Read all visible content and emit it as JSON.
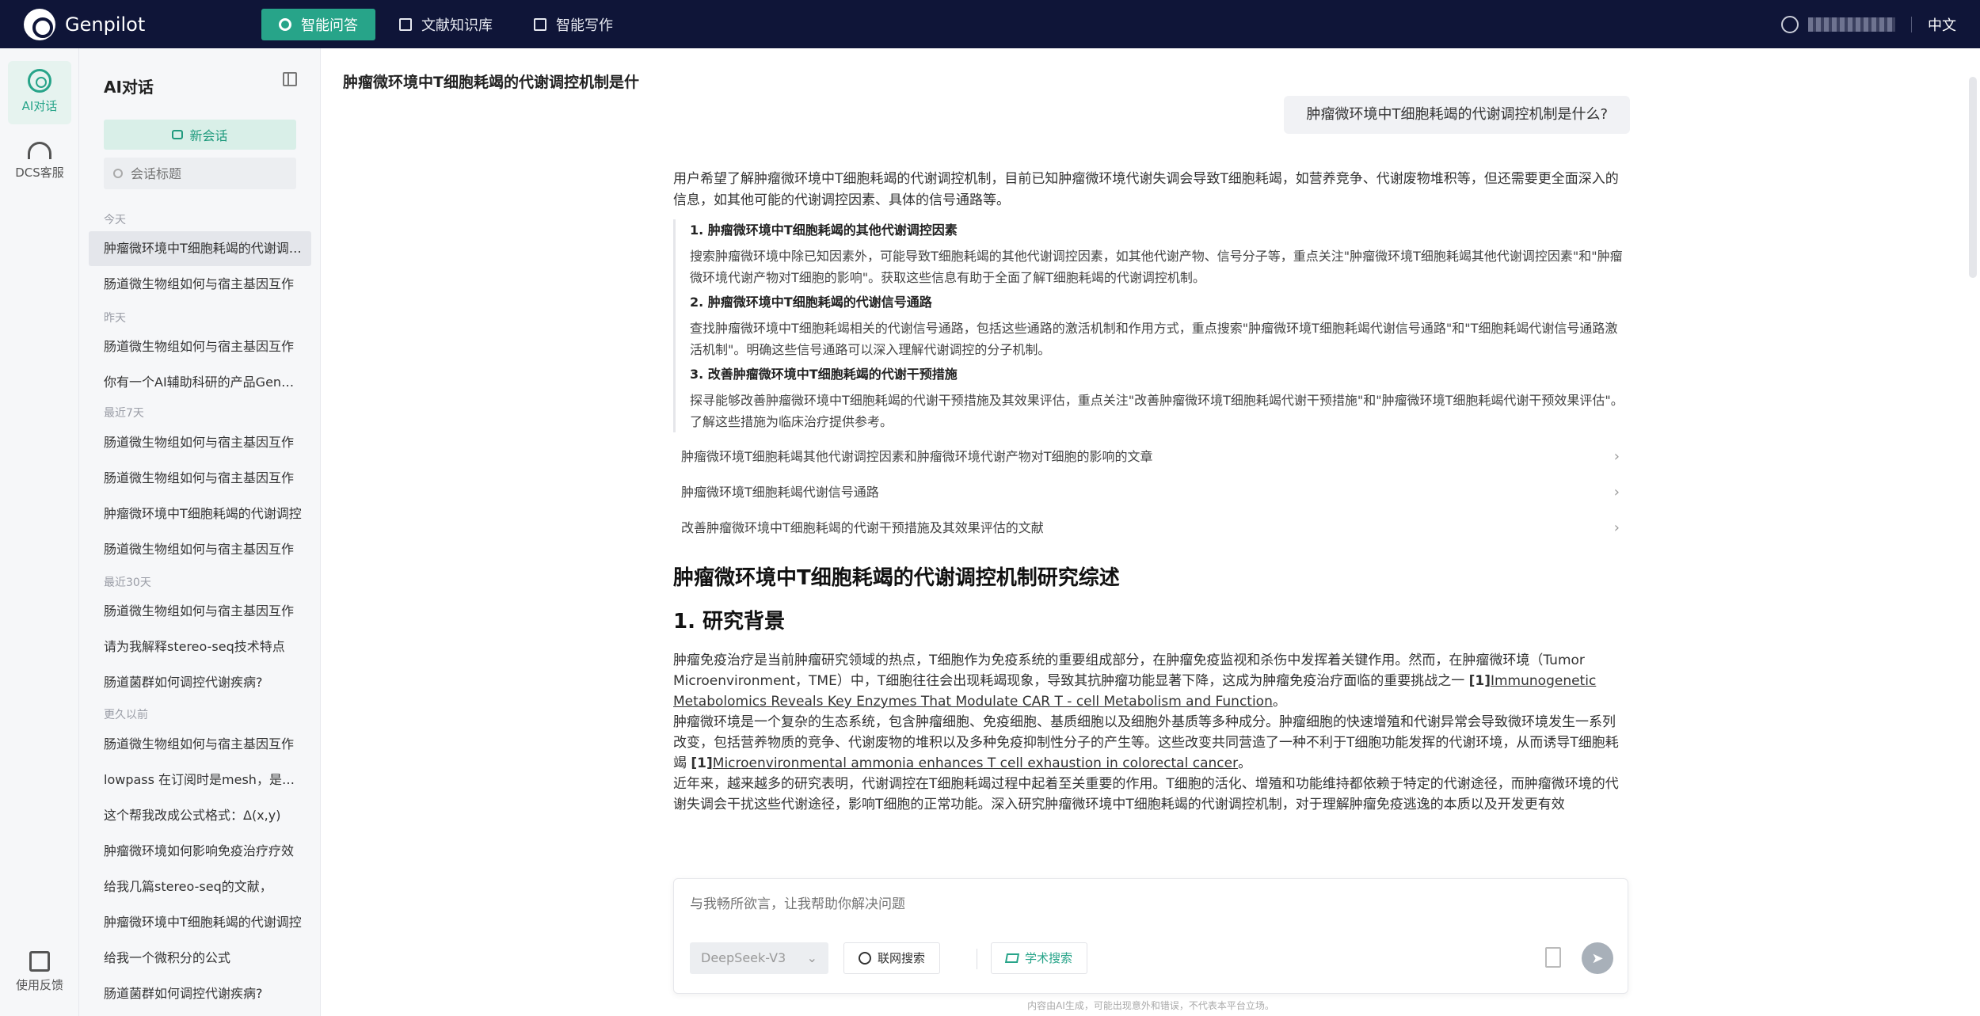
{
  "brand": {
    "name": "Genpilot"
  },
  "nav": [
    {
      "label": "智能问答",
      "icon": "gear-icon",
      "active": true
    },
    {
      "label": "文献知识库",
      "icon": "book-icon",
      "active": false
    },
    {
      "label": "智能写作",
      "icon": "pen-icon",
      "active": false
    }
  ],
  "topbar": {
    "language": "中文"
  },
  "rail": {
    "ai_chat": "AI对话",
    "dcs": "DCS客服",
    "feedback": "使用反馈"
  },
  "sidebar": {
    "title": "AI对话",
    "new_chat": "新会话",
    "search_placeholder": "会话标题",
    "groups": {
      "today": "今天",
      "yesterday": "昨天",
      "last7": "最近7天",
      "last30": "最近30天",
      "older": "更久以前"
    },
    "items": [
      "肿瘤微环境中T细胞耗竭的代谢调控机制是什么？",
      "肠道微生物组如何与宿主基因互作",
      "肠道微生物组如何与宿主基因互作",
      "你有一个AI辅助科研的产品Genpilot",
      "肠道微生物组如何与宿主基因互作",
      "肠道微生物组如何与宿主基因互作",
      "肿瘤微环境中T细胞耗竭的代谢调控",
      "肠道微生物组如何与宿主基因互作",
      "肠道微生物组如何与宿主基因互作",
      "请为我解释stereo-seq技术特点",
      "肠道菌群如何调控代谢疾病?",
      "肠道微生物组如何与宿主基因互作",
      "lowpass 在订阅时是mesh，是什么",
      "这个帮我改成公式格式：Δ(x,y)",
      "肿瘤微环境如何影响免疫治疗疗效",
      "给我几篇stereo-seq的文献，",
      "肿瘤微环境中T细胞耗竭的代谢调控",
      "给我一个微积分的公式",
      "肠道菌群如何调控代谢疾病?"
    ]
  },
  "main": {
    "conversation_title": "肿瘤微环境中T细胞耗竭的代谢调控机制是什",
    "user_question": "肿瘤微环境中T细胞耗竭的代谢调控机制是什么?",
    "intro": "用户希望了解肿瘤微环境中T细胞耗竭的代谢调控机制，目前已知肿瘤微环境代谢失调会导致T细胞耗竭，如营养竞争、代谢废物堆积等，但还需要更全面深入的信息，如其他可能的代谢调控因素、具体的信号通路等。",
    "plan": [
      {
        "heading": "1. 肿瘤微环境中T细胞耗竭的其他代谢调控因素",
        "text": "搜索肿瘤微环境中除已知因素外，可能导致T细胞耗竭的其他代谢调控因素，如其他代谢产物、信号分子等，重点关注\"肿瘤微环境T细胞耗竭其他代谢调控因素\"和\"肿瘤微环境代谢产物对T细胞的影响\"。获取这些信息有助于全面了解T细胞耗竭的代谢调控机制。"
      },
      {
        "heading": "2. 肿瘤微环境中T细胞耗竭的代谢信号通路",
        "text": "查找肿瘤微环境中T细胞耗竭相关的代谢信号通路，包括这些通路的激活机制和作用方式，重点搜索\"肿瘤微环境T细胞耗竭代谢信号通路\"和\"T细胞耗竭代谢信号通路激活机制\"。明确这些信号通路可以深入理解代谢调控的分子机制。"
      },
      {
        "heading": "3. 改善肿瘤微环境中T细胞耗竭的代谢干预措施",
        "text": "探寻能够改善肿瘤微环境中T细胞耗竭的代谢干预措施及其效果评估，重点关注\"改善肿瘤微环境T细胞耗竭代谢干预措施\"和\"肿瘤微环境T细胞耗竭代谢干预效果评估\"。了解这些措施为临床治疗提供参考。"
      }
    ],
    "references": [
      "肿瘤微环境T细胞耗竭其他代谢调控因素和肿瘤微环境代谢产物对T细胞的影响的文章",
      "肿瘤微环境T细胞耗竭代谢信号通路",
      "改善肿瘤微环境中T细胞耗竭的代谢干预措施及其效果评估的文献"
    ],
    "report_title": "肿瘤微环境中T细胞耗竭的代谢调控机制研究综述",
    "section_title": "1. 研究背景",
    "p1_text": "肿瘤免疫治疗是当前肿瘤研究领域的热点，T细胞作为免疫系统的重要组成部分，在肿瘤免疫监视和杀伤中发挥着关键作用。然而，在肿瘤微环境（Tumor Microenvironment，TME）中，T细胞往往会出现耗竭现象，导致其抗肿瘤功能显著下降，这成为肿瘤免疫治疗面临的重要挑战之一",
    "p1_cite_num": "[1]",
    "p1_cite_title": "Immunogenetic Metabolomics Reveals Key Enzymes That Modulate CAR T - cell Metabolism and Function",
    "p1_end": "。",
    "p2_text": "肿瘤微环境是一个复杂的生态系统，包含肿瘤细胞、免疫细胞、基质细胞以及细胞外基质等多种成分。肿瘤细胞的快速增殖和代谢异常会导致微环境发生一系列改变，包括营养物质的竞争、代谢废物的堆积以及多种免疫抑制性分子的产生等。这些改变共同营造了一种不利于T细胞功能发挥的代谢环境，从而诱导T细胞耗竭",
    "p2_cite_num": "[1]",
    "p2_cite_title": "Microenvironmental ammonia enhances T cell exhaustion in colorectal cancer",
    "p2_end": "。",
    "p3_text": "近年来，越来越多的研究表明，代谢调控在T细胞耗竭过程中起着至关重要的作用。T细胞的活化、增殖和功能维持都依赖于特定的代谢途径，而肿瘤微环境的代谢失调会干扰这些代谢途径，影响T细胞的正常功能。深入研究肿瘤微环境中T细胞耗竭的代谢调控机制，对于理解肿瘤免疫逃逸的本质以及开发更有效"
  },
  "composer": {
    "placeholder": "与我畅所欲言，让我帮助你解决问题",
    "model": "DeepSeek-V3",
    "web_search": "联网搜索",
    "academic_search": "学术搜索",
    "disclaimer": "内容由AI生成，可能出现意外和错误，不代表本平台立场。"
  }
}
